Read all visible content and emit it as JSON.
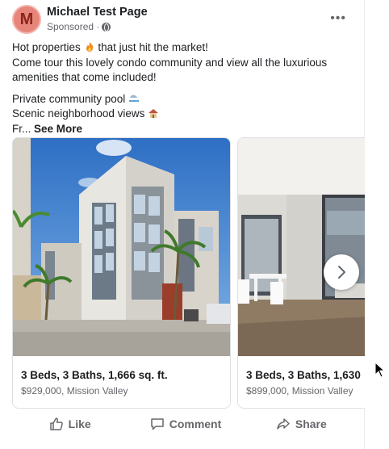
{
  "header": {
    "avatar_letter": "M",
    "page_name": "Michael Test Page",
    "sponsored": "Sponsored ·",
    "more": "•••"
  },
  "post_text": {
    "line1": "Hot properties",
    "line1_tail": "that just hit the market!",
    "line2": "Come tour this lovely condo community and view all the luxurious",
    "line3": "amenities that come included!",
    "line4": "Private community pool",
    "line5": "Scenic neighborhood views",
    "line6_prefix": "Fr...",
    "see_more": "See More"
  },
  "carousel": {
    "cards": [
      {
        "title": "3 Beds, 3 Baths, 1,666 sq. ft.",
        "subtitle": "$929,000, Mission Valley",
        "image": "condo-building-exterior"
      },
      {
        "title": "3 Beds, 3 Baths, 1,630",
        "subtitle": "$899,000, Mission Valley",
        "image": "condo-interior-living-room"
      }
    ]
  },
  "actions": {
    "like": "Like",
    "comment": "Comment",
    "share": "Share"
  },
  "colors": {
    "avatar_bg": "#e8857a",
    "text_primary": "#1c1e21",
    "text_secondary": "#65676b",
    "border": "#dddfe2"
  }
}
